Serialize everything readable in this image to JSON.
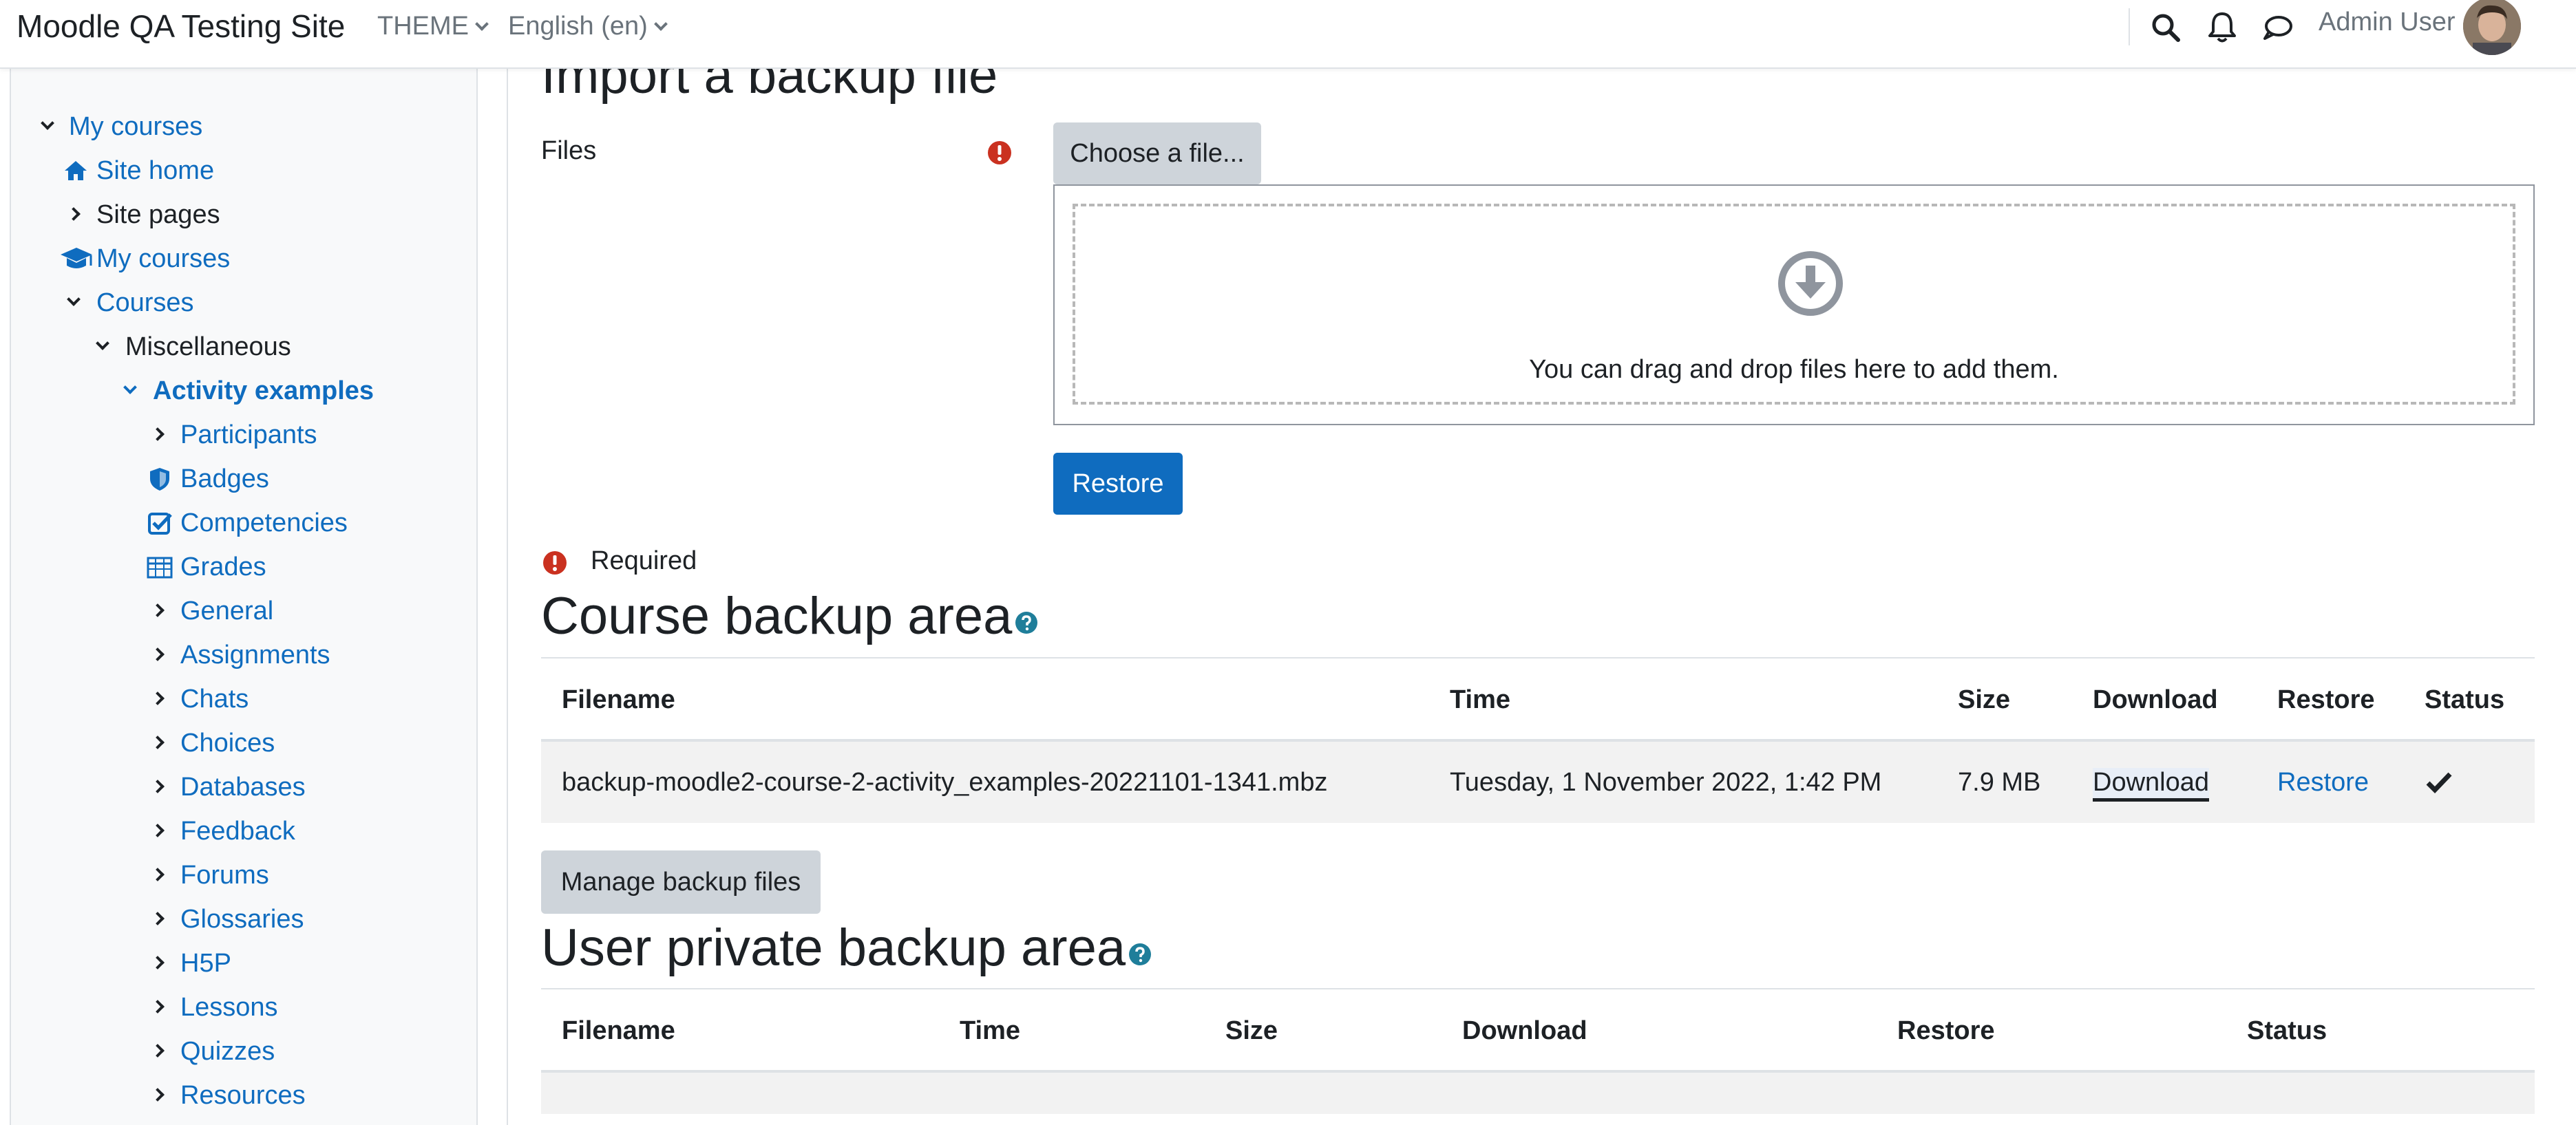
{
  "navbar": {
    "brand": "Moodle QA Testing Site",
    "theme_label": "THEME",
    "language_label": "English (en)",
    "user_name": "Admin User"
  },
  "drawer": {
    "items": [
      {
        "label": "My courses",
        "icon": "chevron-down"
      },
      {
        "label": "Site home",
        "icon": "home-icon"
      },
      {
        "label": "Site pages",
        "icon": "chevron-right"
      },
      {
        "label": "My courses",
        "icon": "graduation-cap-icon"
      },
      {
        "label": "Courses",
        "icon": "chevron-down"
      },
      {
        "label": "Miscellaneous",
        "icon": "chevron-down"
      },
      {
        "label": "Activity examples",
        "icon": "chevron-down"
      },
      {
        "label": "Participants",
        "icon": "chevron-right"
      },
      {
        "label": "Badges",
        "icon": "shield-icon"
      },
      {
        "label": "Competencies",
        "icon": "check-square-icon"
      },
      {
        "label": "Grades",
        "icon": "table-icon"
      },
      {
        "label": "General",
        "icon": "chevron-right"
      },
      {
        "label": "Assignments",
        "icon": "chevron-right"
      },
      {
        "label": "Chats",
        "icon": "chevron-right"
      },
      {
        "label": "Choices",
        "icon": "chevron-right"
      },
      {
        "label": "Databases",
        "icon": "chevron-right"
      },
      {
        "label": "Feedback",
        "icon": "chevron-right"
      },
      {
        "label": "Forums",
        "icon": "chevron-right"
      },
      {
        "label": "Glossaries",
        "icon": "chevron-right"
      },
      {
        "label": "H5P",
        "icon": "chevron-right"
      },
      {
        "label": "Lessons",
        "icon": "chevron-right"
      },
      {
        "label": "Quizzes",
        "icon": "chevron-right"
      },
      {
        "label": "Resources",
        "icon": "chevron-right"
      }
    ]
  },
  "import": {
    "heading": "Import a backup file",
    "files_label": "Files",
    "choose_button": "Choose a file...",
    "drop_text": "You can drag and drop files here to add them.",
    "restore_button": "Restore",
    "required_text": "Required"
  },
  "course_backup": {
    "heading": "Course backup area",
    "headers": {
      "filename": "Filename",
      "time": "Time",
      "size": "Size",
      "download": "Download",
      "restore": "Restore",
      "status": "Status"
    },
    "rows": [
      {
        "filename": "backup-moodle2-course-2-activity_examples-20221101-1341.mbz",
        "time": "Tuesday, 1 November 2022, 1:42 PM",
        "size": "7.9 MB",
        "download": "Download",
        "restore": "Restore",
        "status": "check-icon"
      }
    ],
    "manage_button": "Manage backup files"
  },
  "user_backup": {
    "heading": "User private backup area",
    "headers": {
      "filename": "Filename",
      "time": "Time",
      "size": "Size",
      "download": "Download",
      "restore": "Restore",
      "status": "Status"
    }
  },
  "colors": {
    "link": "#0f6cbf",
    "required": "#ca3120",
    "help": "#1f7e9a",
    "button_secondary": "#ced4da"
  }
}
